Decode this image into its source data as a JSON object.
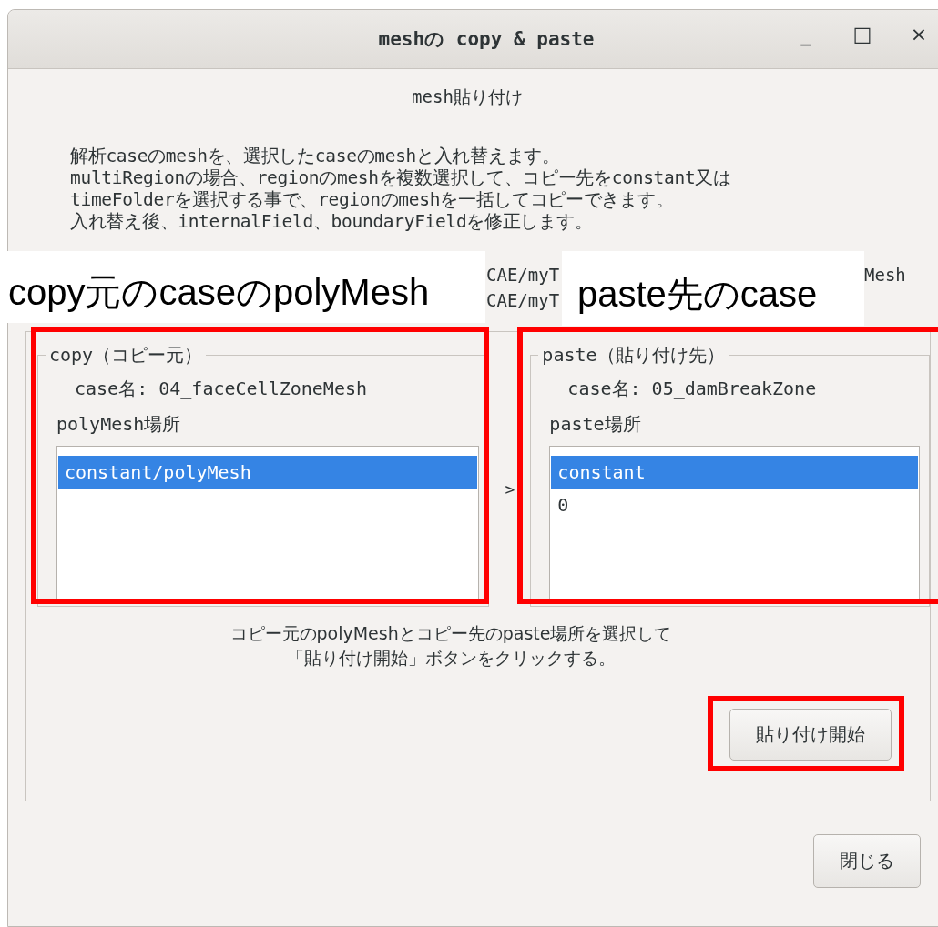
{
  "window": {
    "title": "meshの copy & paste",
    "controls": [
      "_",
      "□",
      "×"
    ]
  },
  "heading": "mesh貼り付け",
  "description": [
    "解析caseのmeshを、選択したcaseのmeshと入れ替えます。",
    "multiRegionの場合、regionのmeshを複数選択して、コピー先をconstant又は",
    "timeFolderを選択する事で、regionのmeshを一括してコピーできます。",
    "入れ替え後、internalField、boundaryFieldを修正します。"
  ],
  "path_fragments": {
    "left": [
      "CAE/myT",
      "CAE/myT"
    ],
    "right": "Mesh"
  },
  "annotations": [
    {
      "label": "copy元のcaseのpolyMesh"
    },
    {
      "label": "paste先のcase"
    }
  ],
  "groups": [
    {
      "legend": "copy（コピー元）",
      "case": "case名: 04_faceCellZoneMesh",
      "list_label": "polyMesh場所",
      "highlighted": true,
      "items": [
        {
          "label": "constant/polyMesh",
          "selected": true
        }
      ]
    },
    {
      "legend": "paste（貼り付け先）",
      "case": "case名: 05_damBreakZone",
      "list_label": "paste場所",
      "highlighted": true,
      "items": [
        {
          "label": "constant",
          "selected": true
        },
        {
          "label": "0",
          "selected": false
        }
      ]
    }
  ],
  "arrow": ">",
  "instruction": [
    "コピー元のpolyMeshとコピー先のpaste場所を選択して",
    "「貼り付け開始」ボタンをクリックする。"
  ],
  "start_button": {
    "label": "貼り付け開始",
    "highlighted": true
  },
  "close_button": "閉じる"
}
